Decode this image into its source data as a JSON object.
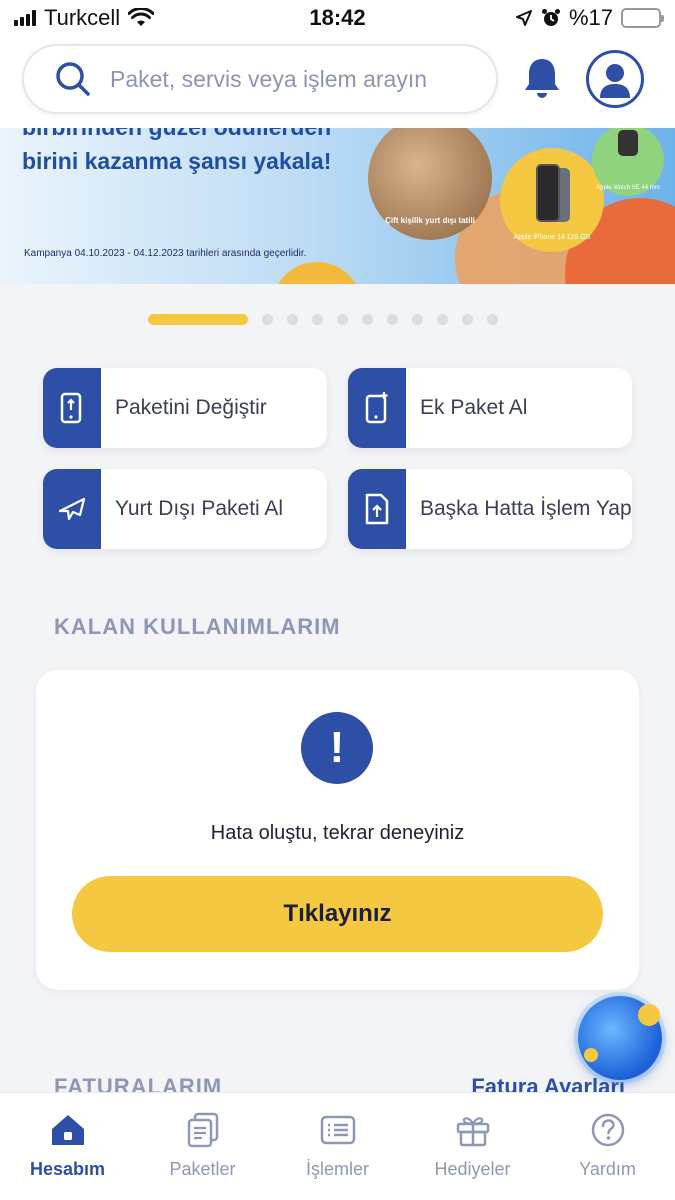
{
  "status_bar": {
    "carrier": "Turkcell",
    "time": "18:42",
    "battery_percent": "%17",
    "battery_level": 0.17,
    "icons": [
      "signal-icon",
      "wifi-icon",
      "location-icon",
      "alarm-icon",
      "battery-icon"
    ]
  },
  "header": {
    "search_placeholder": "Paket, servis veya işlem arayın",
    "icons": [
      "search-icon",
      "bell-icon",
      "user-icon"
    ]
  },
  "banner": {
    "headline_top": "birbirinden güzel ödüllerden",
    "headline": "birini kazanma şansı yakala!",
    "note": "Kampanya 04.10.2023 - 04.12.2023 tarihleri arasında geçerlidir.",
    "prize_1": "Çift kişilik yurt dışı tatili",
    "prize_2": "Apple iPhone 14 128 GB",
    "prize_3": "Apple Watch SE 44 mm"
  },
  "pager": {
    "active_index": 0,
    "total": 11
  },
  "quick_actions": [
    {
      "label": "Paketini Değiştir",
      "icon": "phone-swap-icon"
    },
    {
      "label": "Ek Paket Al",
      "icon": "phone-plus-icon"
    },
    {
      "label": "Yurt Dışı Paketi Al",
      "icon": "airplane-icon"
    },
    {
      "label": "Başka Hatta İşlem Yap",
      "icon": "upload-doc-icon"
    }
  ],
  "usage": {
    "title": "KALAN KULLANIMLARIM",
    "error_text": "Hata oluştu, tekrar deneyiniz",
    "retry_label": "Tıklayınız"
  },
  "bills": {
    "title": "FATURALARIM",
    "settings_link": "Fatura Ayarları"
  },
  "bottom_nav": [
    {
      "label": "Hesabım",
      "icon": "home-icon",
      "active": true
    },
    {
      "label": "Paketler",
      "icon": "packages-icon",
      "active": false
    },
    {
      "label": "İşlemler",
      "icon": "list-icon",
      "active": false
    },
    {
      "label": "Hediyeler",
      "icon": "gift-icon",
      "active": false
    },
    {
      "label": "Yardım",
      "icon": "help-icon",
      "active": false
    }
  ],
  "colors": {
    "primary": "#2e4fa6",
    "accent": "#f5c842",
    "muted": "#8e97b6",
    "background": "#f3f4f6"
  }
}
